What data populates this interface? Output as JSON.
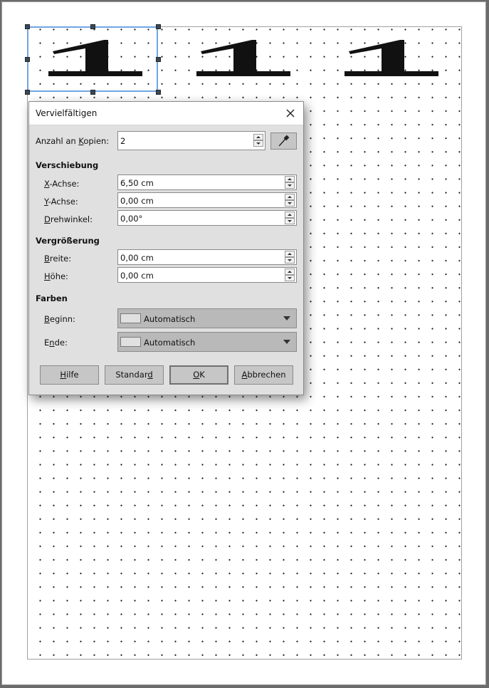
{
  "dialog": {
    "title": "Vervielfältigen",
    "copies": {
      "label_pre": "Anzahl an ",
      "label_u": "K",
      "label_post": "opien:",
      "value": "2"
    },
    "shift": {
      "heading": "Verschiebung",
      "x": {
        "label_u": "X",
        "label_post": "-Achse:",
        "value": "6,50 cm"
      },
      "y": {
        "label_u": "Y",
        "label_post": "-Achse:",
        "value": "0,00 cm"
      },
      "angle": {
        "label_u": "D",
        "label_post": "rehwinkel:",
        "value": "0,00°"
      }
    },
    "enlarge": {
      "heading": "Vergrößerung",
      "width": {
        "label_u": "B",
        "label_post": "reite:",
        "value": "0,00 cm"
      },
      "height": {
        "label_u": "H",
        "label_post": "öhe:",
        "value": "0,00 cm"
      }
    },
    "colors": {
      "heading": "Farben",
      "start": {
        "label_u": "B",
        "label_post": "eginn:",
        "value": "Automatisch"
      },
      "end": {
        "label_pre": "E",
        "label_u": "n",
        "label_post": "de:",
        "value": "Automatisch"
      }
    },
    "buttons": {
      "help": {
        "u": "H",
        "rest": "ilfe"
      },
      "reset": {
        "pre": "Standar",
        "u": "d",
        "rest": ""
      },
      "ok": {
        "u": "O",
        "rest": "K"
      },
      "cancel": {
        "u": "A",
        "rest": "bbrechen"
      }
    }
  },
  "icons": {
    "close": "close-icon",
    "pipette": "pipette-icon",
    "glyph": "numeral-one-shape"
  }
}
